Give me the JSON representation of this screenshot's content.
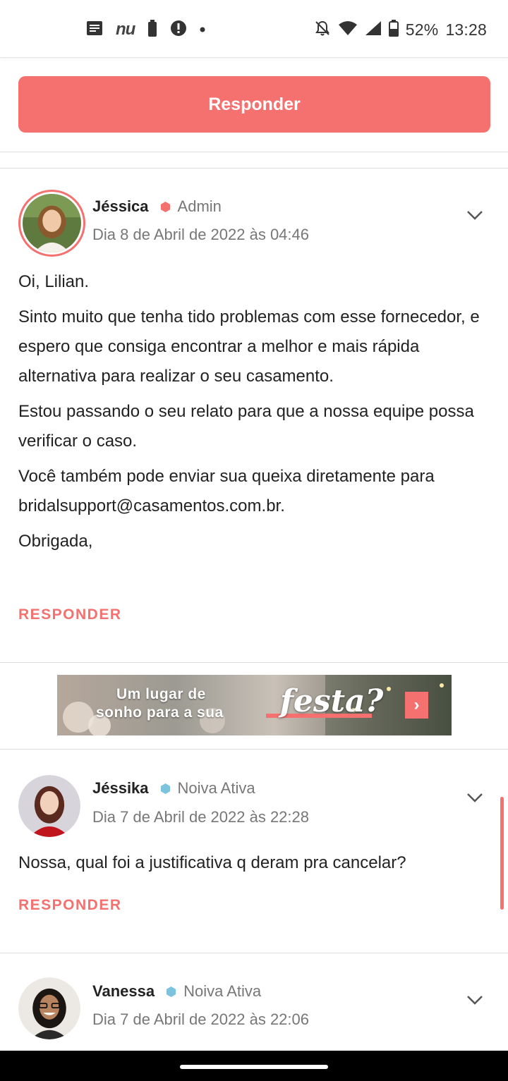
{
  "status_bar": {
    "left_icons": [
      "notes-icon",
      "nubank-icon",
      "battery-saver-icon",
      "alert-icon",
      "more-dot-icon"
    ],
    "nu_label": "nu",
    "right_icons": [
      "notifications-off-icon",
      "wifi-icon",
      "signal-icon",
      "battery-icon"
    ],
    "battery": "52%",
    "time": "13:28"
  },
  "top_reply_button": "Responder",
  "comments": [
    {
      "author": "Jéssica",
      "role": "Admin",
      "role_color": "#f47170",
      "date": "Dia 8 de Abril de 2022 às 04:46",
      "paragraphs": [
        "Oi, Lilian.",
        "Sinto muito que tenha tido problemas com esse fornecedor, e espero que consiga encontrar a melhor e mais rápida alternativa para realizar o seu casamento.",
        "Estou passando o seu relato para que a nossa equipe possa verificar o caso.",
        "Você também pode enviar sua queixa diretamente para bridalsupport@casamentos.com.br.",
        "Obrigada,"
      ],
      "reply": "RESPONDER"
    },
    {
      "author": "Jéssika",
      "role": "Noiva Ativa",
      "role_color": "#7ec3de",
      "date": "Dia 7 de Abril de 2022 às 22:28",
      "paragraphs": [
        "Nossa, qual foi a justificativa q deram pra cancelar?"
      ],
      "reply": "RESPONDER"
    },
    {
      "author": "Vanessa",
      "role": "Noiva Ativa",
      "role_color": "#7ec3de",
      "date": "Dia 7 de Abril de 2022 às 22:06"
    }
  ],
  "ad": {
    "line1": "Um lugar de",
    "line2": "sonho para a sua",
    "highlight": "festa?",
    "arrow": "›"
  },
  "colors": {
    "accent": "#f47170",
    "text": "#222222",
    "muted": "#777777"
  }
}
